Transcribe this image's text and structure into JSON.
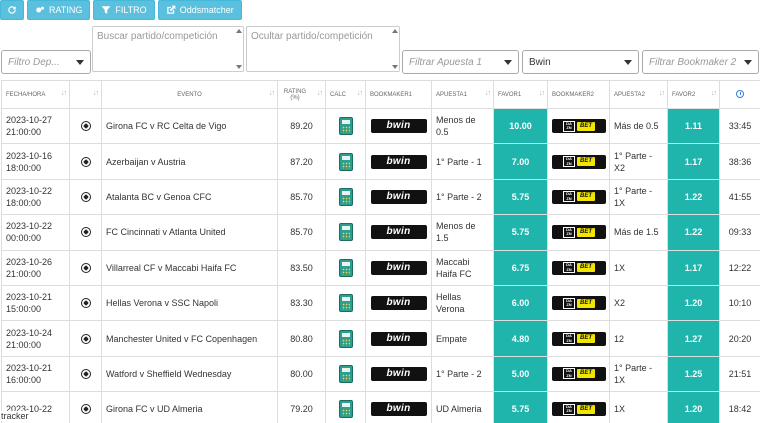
{
  "toolbar": {
    "refresh_icon": "refresh-icon",
    "rating_label": "RATING",
    "filtro_label": "FILTRO",
    "oddsmatcher_label": "Oddsmatcher"
  },
  "filters": {
    "deporte_placeholder": "Filtro Dep...",
    "buscar_placeholder": "Buscar partido/competición",
    "ocultar_placeholder": "Ocultar partido/competición",
    "apuesta1_placeholder": "Filtrar Apuesta 1",
    "bookmaker1_value": "Bwin",
    "bookmaker2_placeholder": "Filtrar Bookmaker 2"
  },
  "table": {
    "headers": {
      "fecha": "FECHA/HORA",
      "evento": "EVENTO",
      "rating": "RATING (%)",
      "calc": "CALC",
      "bookmaker1": "BOOKMAKER1",
      "apuesta1": "APUESTA1",
      "favor1": "FAVOR1",
      "bookmaker2": "BOOKMAKER2",
      "apuesta2": "APUESTA2",
      "favor2": "FAVOR2"
    },
    "sort_glyph": "↓↑",
    "bookmaker1_logo": "bwin",
    "bookmaker2_logo_left": "DA ZN",
    "bookmaker2_logo_right": "BET",
    "rows": [
      {
        "date": "2023-10-27",
        "time": "21:00:00",
        "event": "Girona FC v RC Celta de Vigo",
        "rating": "89.20",
        "apuesta1": "Menos de 0.5",
        "favor1": "10.00",
        "apuesta2": "Más de 0.5",
        "favor2": "1.11",
        "clock": "33:45"
      },
      {
        "date": "2023-10-16",
        "time": "18:00:00",
        "event": "Azerbaijan v Austria",
        "rating": "87.20",
        "apuesta1": "1° Parte - 1",
        "favor1": "7.00",
        "apuesta2": "1° Parte - X2",
        "favor2": "1.17",
        "clock": "38:36"
      },
      {
        "date": "2023-10-22",
        "time": "18:00:00",
        "event": "Atalanta BC v Genoa CFC",
        "rating": "85.70",
        "apuesta1": "1° Parte - 2",
        "favor1": "5.75",
        "apuesta2": "1° Parte - 1X",
        "favor2": "1.22",
        "clock": "41:55"
      },
      {
        "date": "2023-10-22",
        "time": "00:00:00",
        "event": "FC Cincinnati v Atlanta United",
        "rating": "85.70",
        "apuesta1": "Menos de 1.5",
        "favor1": "5.75",
        "apuesta2": "Más de 1.5",
        "favor2": "1.22",
        "clock": "09:33"
      },
      {
        "date": "2023-10-26",
        "time": "21:00:00",
        "event": "Villarreal CF v Maccabi Haifa FC",
        "rating": "83.50",
        "apuesta1": "Maccabi Haifa FC",
        "favor1": "6.75",
        "apuesta2": "1X",
        "favor2": "1.17",
        "clock": "12:22"
      },
      {
        "date": "2023-10-21",
        "time": "15:00:00",
        "event": "Hellas Verona v SSC Napoli",
        "rating": "83.30",
        "apuesta1": "Hellas Verona",
        "favor1": "6.00",
        "apuesta2": "X2",
        "favor2": "1.20",
        "clock": "10:10"
      },
      {
        "date": "2023-10-24",
        "time": "21:00:00",
        "event": "Manchester United v FC Copenhagen",
        "rating": "80.80",
        "apuesta1": "Empate",
        "favor1": "4.80",
        "apuesta2": "12",
        "favor2": "1.27",
        "clock": "20:20"
      },
      {
        "date": "2023-10-21",
        "time": "16:00:00",
        "event": "Watford v Sheffield Wednesday",
        "rating": "80.00",
        "apuesta1": "1° Parte - 2",
        "favor1": "5.00",
        "apuesta2": "1° Parte - 1X",
        "favor2": "1.25",
        "clock": "21:51"
      },
      {
        "date": "2023-10-22",
        "time": "",
        "event": "Girona FC v UD Almeria",
        "rating": "79.20",
        "apuesta1": "UD Almeria",
        "favor1": "5.75",
        "apuesta2": "1X",
        "favor2": "1.20",
        "clock": "18:42"
      }
    ]
  },
  "tracker_label": "tracker",
  "colors": {
    "button": "#5bc0de",
    "favor": "#1fb5ad"
  }
}
